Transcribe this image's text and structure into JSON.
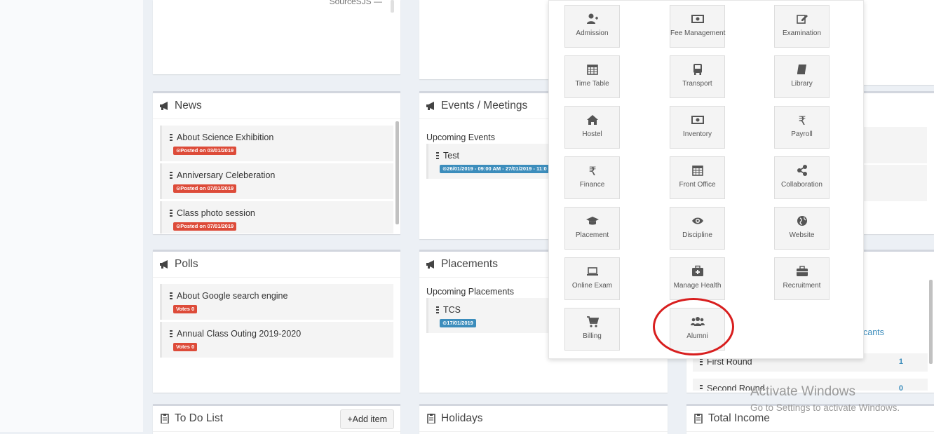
{
  "top": {
    "source_text": "SourceSJS —"
  },
  "news": {
    "title": "News",
    "items": [
      {
        "title": "About Science Exhibition",
        "badge": "Posted on 03/01/2019"
      },
      {
        "title": "Anniversary Celeberation",
        "badge": "Posted on 07/01/2019"
      },
      {
        "title": "Class photo session",
        "badge": "Posted on 07/01/2019"
      }
    ]
  },
  "events": {
    "title": "Events / Meetings",
    "subhead": "Upcoming Events",
    "item_title": "Test",
    "item_badge": "26/01/2019 - 09:00 AM - 27/01/2019 - 11:0"
  },
  "polls": {
    "title": "Polls",
    "items": [
      {
        "title": "About Google search engine",
        "badge": "Votes 0"
      },
      {
        "title": "Annual Class Outing 2019-2020",
        "badge": "Votes 0"
      }
    ]
  },
  "placements": {
    "title": "Placements",
    "subhead": "Upcoming Placements",
    "item_title": "TCS",
    "item_badge": "17/01/2019"
  },
  "vacancies": {
    "link_fragment": "cants",
    "rows": [
      {
        "title": "First Round",
        "count": "1"
      },
      {
        "title": "Second Round",
        "count": "0"
      }
    ]
  },
  "todo": {
    "title": "To Do List",
    "add_label": "+Add item"
  },
  "holidays": {
    "title": "Holidays"
  },
  "income": {
    "title": "Total Income"
  },
  "menu": {
    "tiles": [
      {
        "label": "Admission",
        "icon": "user-plus-icon"
      },
      {
        "label": "Fee Management",
        "icon": "money-icon"
      },
      {
        "label": "Examination",
        "icon": "edit-icon"
      },
      {
        "label": "Time Table",
        "icon": "calendar-icon"
      },
      {
        "label": "Transport",
        "icon": "bus-icon"
      },
      {
        "label": "Library",
        "icon": "book-icon"
      },
      {
        "label": "Hostel",
        "icon": "home-icon"
      },
      {
        "label": "Inventory",
        "icon": "money-icon"
      },
      {
        "label": "Payroll",
        "icon": "rupee-icon"
      },
      {
        "label": "Finance",
        "icon": "rupee-icon"
      },
      {
        "label": "Front Office",
        "icon": "calendar-icon"
      },
      {
        "label": "Collaboration",
        "icon": "share-icon"
      },
      {
        "label": "Placement",
        "icon": "graduation-cap-icon"
      },
      {
        "label": "Discipline",
        "icon": "eye-icon"
      },
      {
        "label": "Website",
        "icon": "globe-icon"
      },
      {
        "label": "Online Exam",
        "icon": "laptop-icon"
      },
      {
        "label": "Manage Health",
        "icon": "medkit-icon"
      },
      {
        "label": "Recruitment",
        "icon": "briefcase-icon"
      },
      {
        "label": "Billing",
        "icon": "cart-icon"
      },
      {
        "label": "Alumni",
        "icon": "users-icon"
      }
    ]
  },
  "watermark": {
    "line1": "Activate Windows",
    "line2": "Go to Settings to activate Windows."
  },
  "colors": {
    "red_badge": "#dd4b39",
    "blue_badge": "#3c8dbc",
    "highlight": "#d81e1e"
  }
}
